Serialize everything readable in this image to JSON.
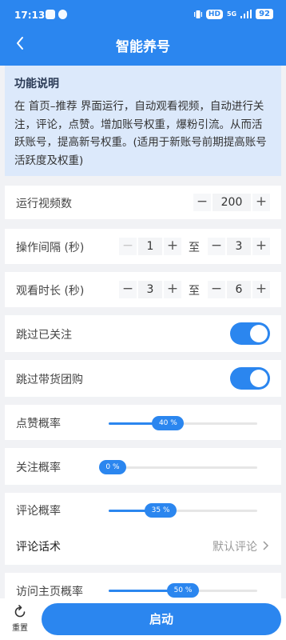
{
  "status_bar": {
    "time": "17:13",
    "network_badge": "HD",
    "signal_text": "5G",
    "battery": "92"
  },
  "header": {
    "title": "智能养号",
    "back_icon": "back-chevron-icon"
  },
  "description": {
    "title": "功能说明",
    "text": "在 首页–推荐 界面运行，自动观看视频，自动进行关注，评论，点赞。增加账号权重，爆粉引流。从而活跃账号，提高新号权重。(适用于新账号前期提高账号活跃度及权重)"
  },
  "settings": {
    "run_videos": {
      "label": "运行视频数",
      "value": "200",
      "minus": "−",
      "plus": "+"
    },
    "interval": {
      "label": "操作间隔 (秒)",
      "min": "1",
      "to": "至",
      "max": "3",
      "minus": "−",
      "plus": "+"
    },
    "watch": {
      "label": "观看时长 (秒)",
      "min": "3",
      "to": "至",
      "max": "6",
      "minus": "−",
      "plus": "+"
    },
    "skip_followed": {
      "label": "跳过已关注",
      "enabled": true
    },
    "skip_group_buy": {
      "label": "跳过带货团购",
      "enabled": true
    },
    "like_rate": {
      "label": "点赞概率",
      "value": 40,
      "text": "40 %"
    },
    "follow_rate": {
      "label": "关注概率",
      "value": 0,
      "text": "0 %"
    },
    "comment_rate": {
      "label": "评论概率",
      "value": 35,
      "text": "35 %"
    },
    "comment_script": {
      "label": "评论话术",
      "value": "默认评论"
    },
    "visit_rate": {
      "label": "访问主页概率",
      "value": 50,
      "text": "50 %"
    }
  },
  "bottom": {
    "reset_label": "重置",
    "start_label": "启动"
  },
  "colors": {
    "primary": "#2b86ef",
    "desc_bg": "#dce9fb",
    "page_bg": "#f1f2f5"
  }
}
